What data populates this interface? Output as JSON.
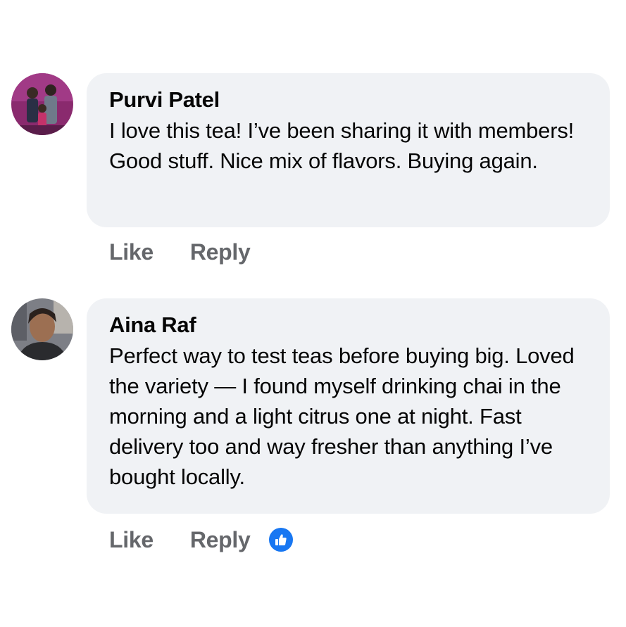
{
  "comments": [
    {
      "author": "Purvi Patel",
      "text": "I love this tea! I’ve been sharing it with members! Good stuff. Nice mix of flavors. Buying again.",
      "actions": {
        "like": "Like",
        "reply": "Reply"
      },
      "reaction_icon": null
    },
    {
      "author": "Aina Raf",
      "text": "Perfect way to test teas before buying big. Loved the variety — I found myself drinking chai in the morning and a light citrus one at night. Fast delivery too and way fresher than anything I’ve bought locally.",
      "actions": {
        "like": "Like",
        "reply": "Reply"
      },
      "reaction_icon": "thumbs-up-icon"
    }
  ],
  "colors": {
    "bubble": "#f0f2f5",
    "author_text": "#050505",
    "action_text": "#65676b",
    "reaction_blue": "#1877f2"
  }
}
